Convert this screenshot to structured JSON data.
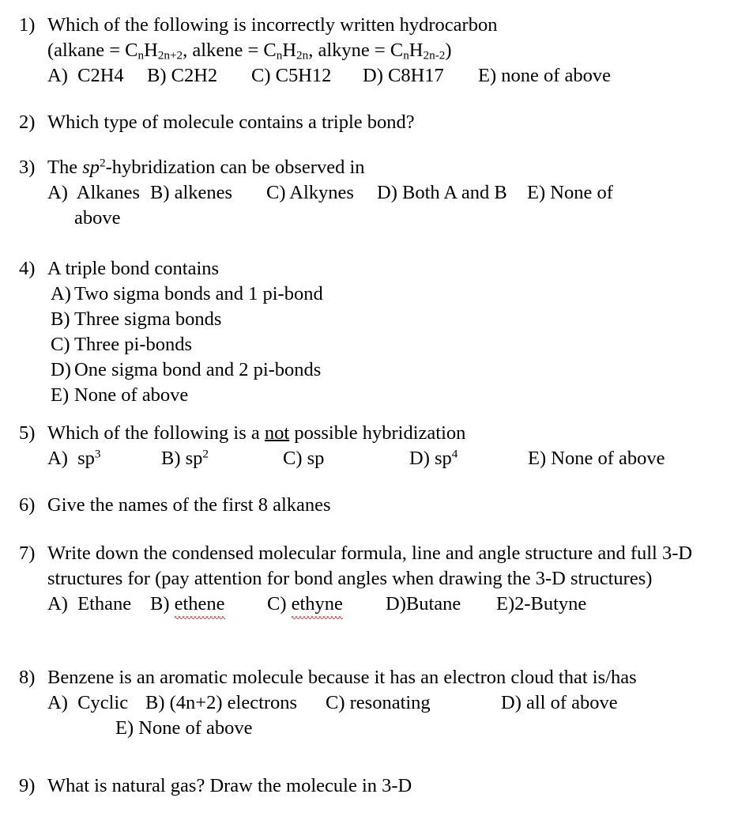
{
  "document": {
    "type": "worksheet",
    "subject": "Organic Chemistry",
    "text_color": "#000000",
    "background_color": "#ffffff",
    "spellcheck_underline_color": "#e02020"
  },
  "questions": [
    {
      "number": "1)",
      "stem": "Which of the following is incorrectly written hydrocarbon",
      "formula_line": {
        "alkane_label": "(alkane = C",
        "alkane_sub1": "n",
        "alkane_h": "H",
        "alkane_sub2": "2n+2",
        "sep1": ", alkene = C",
        "alkene_sub1": "n",
        "alkene_h": "H",
        "alkene_sub2": "2n",
        "sep2": ", alkyne = C",
        "alkyne_sub1": "n",
        "alkyne_h": "H",
        "alkyne_sub2": "2n-2",
        "close": ")"
      },
      "options": [
        {
          "label": "A)",
          "text": "C2H4"
        },
        {
          "label": "B)",
          "text": "C2H2"
        },
        {
          "label": "C)",
          "text": "C5H12"
        },
        {
          "label": "D)",
          "text": "C8H17"
        },
        {
          "label": "E)",
          "text": "none of above"
        }
      ]
    },
    {
      "number": "2)",
      "stem": "Which type of molecule contains a triple bond?",
      "options": []
    },
    {
      "number": "3)",
      "stem_pre": "The ",
      "stem_italic": "sp",
      "stem_sup": "2",
      "stem_post": "-hybridization can be observed in",
      "options": [
        {
          "label": "A)",
          "text": "Alkanes"
        },
        {
          "label": "B)",
          "text": "alkenes"
        },
        {
          "label": "C)",
          "text": "Alkynes"
        },
        {
          "label": "D)",
          "text": "Both A and B"
        },
        {
          "label": "E)",
          "text": "None of"
        }
      ],
      "options_continuation": "above"
    },
    {
      "number": "4)",
      "stem": "A triple bond contains",
      "options": [
        {
          "label": "A)",
          "text": "Two sigma bonds and 1 pi-bond"
        },
        {
          "label": "B)",
          "text": "Three sigma bonds"
        },
        {
          "label": "C)",
          "text": "Three pi-bonds"
        },
        {
          "label": "D)",
          "text": "One sigma bond and 2 pi-bonds"
        },
        {
          "label": "E)",
          "text": "None of above"
        }
      ]
    },
    {
      "number": "5)",
      "stem_pre": "Which of the following is a ",
      "stem_underlined": "not",
      "stem_post": " possible hybridization",
      "options": [
        {
          "label": "A)",
          "base": "sp",
          "sup": "3"
        },
        {
          "label": "B)",
          "base": "sp",
          "sup": "2"
        },
        {
          "label": "C)",
          "base": "sp",
          "sup": ""
        },
        {
          "label": "D)",
          "base": "sp",
          "sup": "4"
        },
        {
          "label": "E)",
          "base": "None of above",
          "sup": ""
        }
      ]
    },
    {
      "number": "6)",
      "stem": "Give the names of the first 8 alkanes",
      "options": []
    },
    {
      "number": "7)",
      "stem": "Write down the condensed molecular formula, line and angle structure and full 3-D structures for (pay attention for bond angles when drawing the 3-D structures)",
      "options": [
        {
          "label": "A)",
          "text": "Ethane",
          "misspelled": false
        },
        {
          "label": "B)",
          "text": "ethene",
          "misspelled": true
        },
        {
          "label": "C)",
          "text": "ethyne",
          "misspelled": true
        },
        {
          "label": "D)",
          "text": "Butane",
          "misspelled": false,
          "no_space": true
        },
        {
          "label": "E)",
          "text": "2-Butyne",
          "misspelled": false,
          "no_space": true
        }
      ]
    },
    {
      "number": "8)",
      "stem": "Benzene is an aromatic molecule because it has an electron cloud that is/has",
      "options": [
        {
          "label": "A)",
          "text": "Cyclic"
        },
        {
          "label": "B)",
          "text": "(4n+2) electrons"
        },
        {
          "label": "C)",
          "text": "resonating"
        },
        {
          "label": "D)",
          "text": "all of above"
        }
      ],
      "options_continuation_label": "E)",
      "options_continuation_text": "None of above"
    },
    {
      "number": "9)",
      "stem": "What is natural gas? Draw the molecule in 3-D",
      "options": []
    }
  ]
}
